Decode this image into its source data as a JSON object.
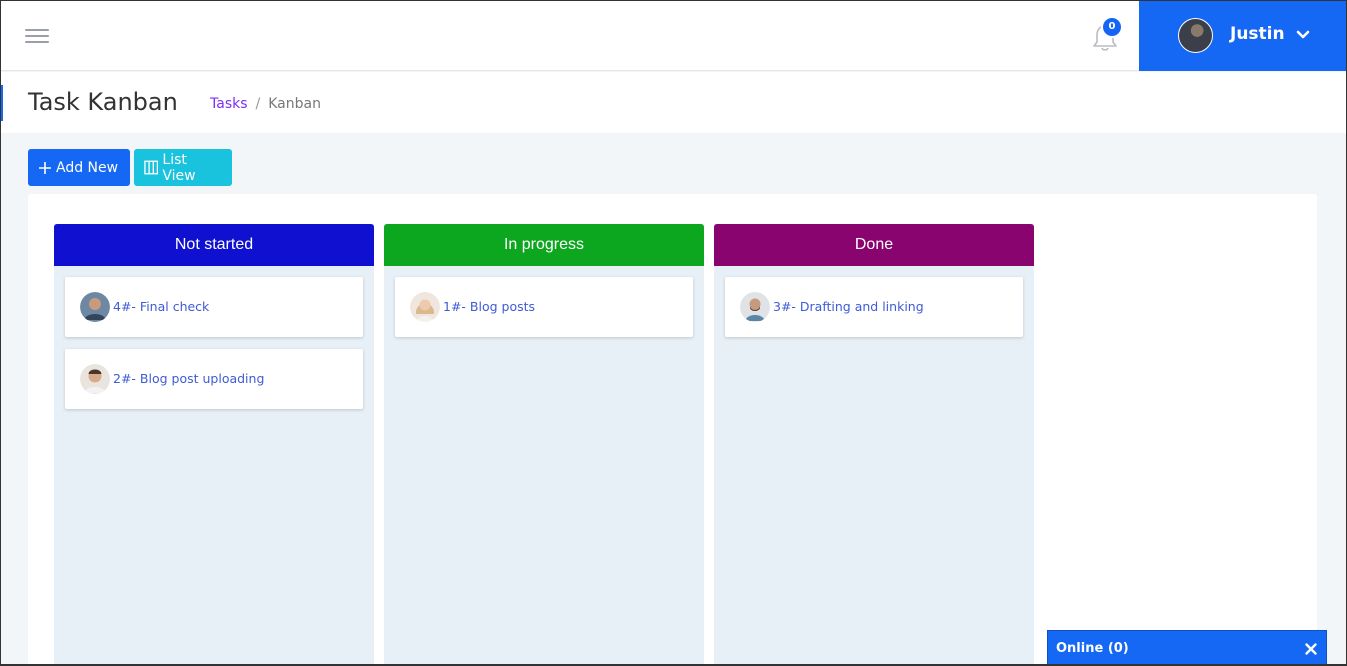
{
  "header": {
    "notification_count": "0",
    "user_name": "Justin"
  },
  "page": {
    "title": "Task Kanban",
    "breadcrumb": {
      "parent": "Tasks",
      "separator": "/",
      "current": "Kanban"
    }
  },
  "toolbar": {
    "add_label": "Add New",
    "list_label": "List View"
  },
  "columns": [
    {
      "label": "Not started",
      "color": "#1010d0",
      "cards": [
        {
          "title": "4#- Final check"
        },
        {
          "title": "2#- Blog post uploading"
        }
      ]
    },
    {
      "label": "In progress",
      "color": "#0ca71e",
      "cards": [
        {
          "title": "1#- Blog posts"
        }
      ]
    },
    {
      "label": "Done",
      "color": "#8a0470",
      "cards": [
        {
          "title": "3#- Drafting and linking"
        }
      ]
    }
  ],
  "chat": {
    "label": "Online (0)"
  },
  "colors": {
    "primary": "#1468f3",
    "info": "#19c2dd",
    "link": "#3f5bd6",
    "breadcrumb_link": "#7b2ff7"
  }
}
